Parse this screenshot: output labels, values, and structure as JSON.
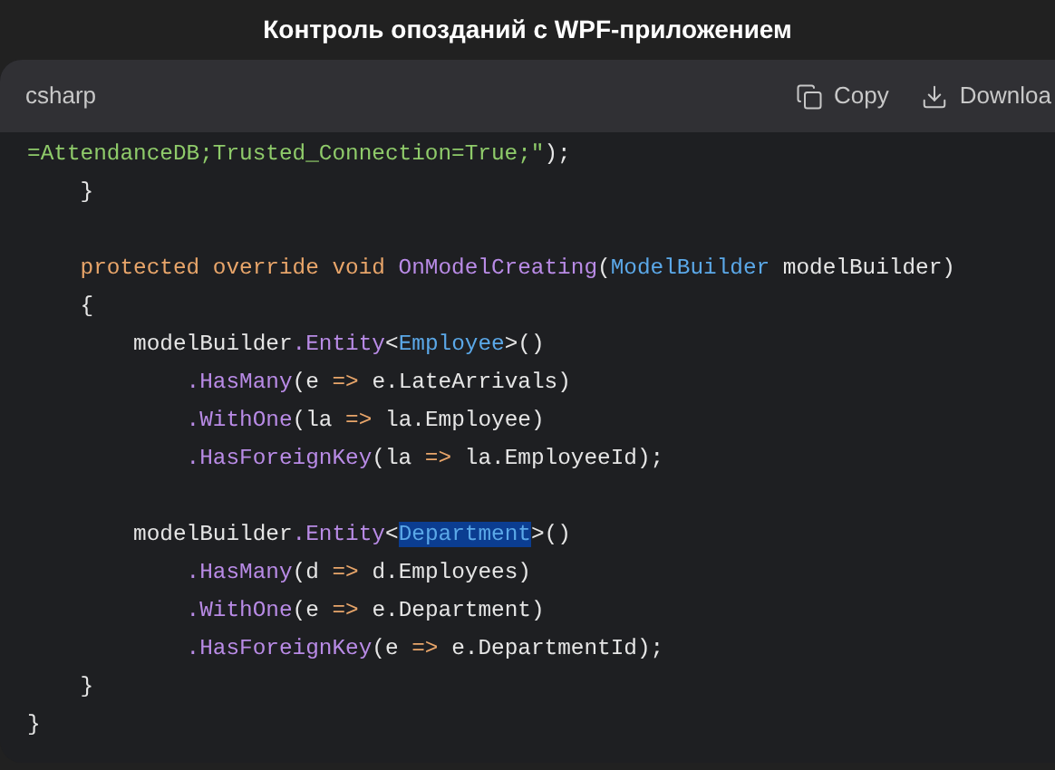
{
  "title": "Контроль опозданий с WPF-приложением",
  "code_block": {
    "language": "csharp",
    "actions": [
      {
        "kind": "copy",
        "label": "Copy"
      },
      {
        "kind": "download",
        "label": "Downloa"
      }
    ],
    "lines": [
      {
        "kind": "code",
        "tokens": [
          {
            "kind": "string",
            "text": "=AttendanceDB;Trusted_Connection=True;\"",
            "selected": false
          },
          {
            "kind": "plain",
            "text": ");",
            "selected": false
          }
        ]
      },
      {
        "kind": "code",
        "tokens": [
          {
            "kind": "plain",
            "text": "    }",
            "selected": false
          }
        ]
      },
      {
        "kind": "blank"
      },
      {
        "kind": "code",
        "tokens": [
          {
            "kind": "keyword",
            "text": "    protected override void ",
            "selected": false
          },
          {
            "kind": "method",
            "text": "OnModelCreating",
            "selected": false
          },
          {
            "kind": "plain",
            "text": "(",
            "selected": false
          },
          {
            "kind": "type",
            "text": "ModelBuilder",
            "selected": false
          },
          {
            "kind": "plain",
            "text": " modelBuilder)",
            "selected": false
          }
        ]
      },
      {
        "kind": "code",
        "tokens": [
          {
            "kind": "plain",
            "text": "    {",
            "selected": false
          }
        ]
      },
      {
        "kind": "code",
        "tokens": [
          {
            "kind": "plain",
            "text": "        modelBuilder",
            "selected": false
          },
          {
            "kind": "method",
            "text": ".Entity",
            "selected": false
          },
          {
            "kind": "plain",
            "text": "<",
            "selected": false
          },
          {
            "kind": "type",
            "text": "Employee",
            "selected": false
          },
          {
            "kind": "plain",
            "text": ">()",
            "selected": false
          }
        ]
      },
      {
        "kind": "code",
        "tokens": [
          {
            "kind": "method",
            "text": "            .HasMany",
            "selected": false
          },
          {
            "kind": "plain",
            "text": "(e ",
            "selected": false
          },
          {
            "kind": "keyword",
            "text": "=>",
            "selected": false
          },
          {
            "kind": "plain",
            "text": " e.LateArrivals)",
            "selected": false
          }
        ]
      },
      {
        "kind": "code",
        "tokens": [
          {
            "kind": "method",
            "text": "            .WithOne",
            "selected": false
          },
          {
            "kind": "plain",
            "text": "(la ",
            "selected": false
          },
          {
            "kind": "keyword",
            "text": "=>",
            "selected": false
          },
          {
            "kind": "plain",
            "text": " la.Employee)",
            "selected": false
          }
        ]
      },
      {
        "kind": "code",
        "tokens": [
          {
            "kind": "method",
            "text": "            .HasForeignKey",
            "selected": false
          },
          {
            "kind": "plain",
            "text": "(la ",
            "selected": false
          },
          {
            "kind": "keyword",
            "text": "=>",
            "selected": false
          },
          {
            "kind": "plain",
            "text": " la.EmployeeId);",
            "selected": false
          }
        ]
      },
      {
        "kind": "blank"
      },
      {
        "kind": "code",
        "tokens": [
          {
            "kind": "plain",
            "text": "        modelBuilder",
            "selected": false
          },
          {
            "kind": "method",
            "text": ".Entity",
            "selected": false
          },
          {
            "kind": "plain",
            "text": "<",
            "selected": false
          },
          {
            "kind": "type",
            "text": "Department",
            "selected": true
          },
          {
            "kind": "plain",
            "text": ">()",
            "selected": false
          }
        ]
      },
      {
        "kind": "code",
        "tokens": [
          {
            "kind": "method",
            "text": "            .HasMany",
            "selected": false
          },
          {
            "kind": "plain",
            "text": "(d ",
            "selected": false
          },
          {
            "kind": "keyword",
            "text": "=>",
            "selected": false
          },
          {
            "kind": "plain",
            "text": " d.Employees)",
            "selected": false
          }
        ]
      },
      {
        "kind": "code",
        "tokens": [
          {
            "kind": "method",
            "text": "            .WithOne",
            "selected": false
          },
          {
            "kind": "plain",
            "text": "(e ",
            "selected": false
          },
          {
            "kind": "keyword",
            "text": "=>",
            "selected": false
          },
          {
            "kind": "plain",
            "text": " e.Department)",
            "selected": false
          }
        ]
      },
      {
        "kind": "code",
        "tokens": [
          {
            "kind": "method",
            "text": "            .HasForeignKey",
            "selected": false
          },
          {
            "kind": "plain",
            "text": "(e ",
            "selected": false
          },
          {
            "kind": "keyword",
            "text": "=>",
            "selected": false
          },
          {
            "kind": "plain",
            "text": " e.DepartmentId);",
            "selected": false
          }
        ]
      },
      {
        "kind": "code",
        "tokens": [
          {
            "kind": "plain",
            "text": "    }",
            "selected": false
          }
        ]
      },
      {
        "kind": "code",
        "tokens": [
          {
            "kind": "plain",
            "text": "}",
            "selected": false
          }
        ]
      }
    ]
  }
}
